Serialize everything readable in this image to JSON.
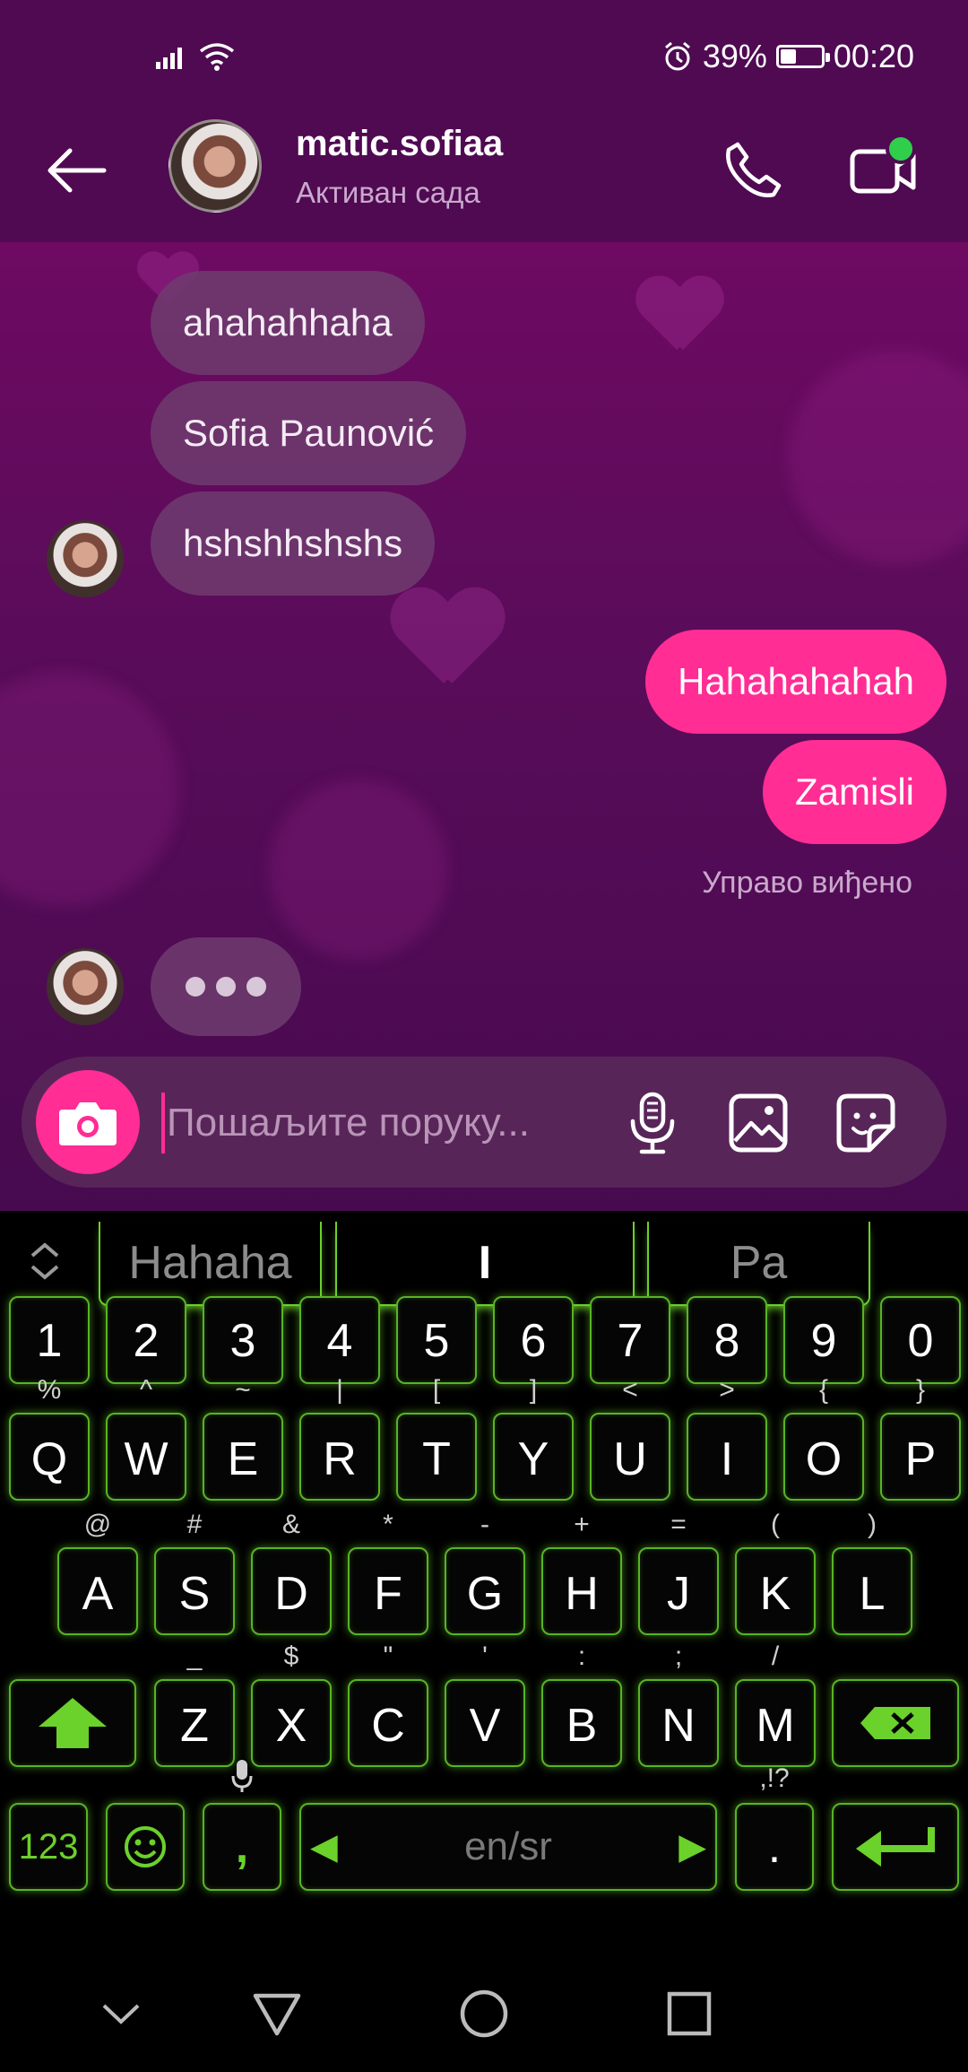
{
  "status_bar": {
    "battery": "39%",
    "battery_level": 0.39,
    "time": "00:20",
    "icons": [
      "signal-icon",
      "wifi-icon",
      "alarm-icon",
      "battery-icon"
    ]
  },
  "header": {
    "contact_name": "matic.sofiaa",
    "contact_status": "Активан сада",
    "icons": [
      "back-arrow-icon",
      "phone-icon",
      "video-call-icon"
    ]
  },
  "messages": [
    {
      "direction": "incoming",
      "text": "ahahahhaha"
    },
    {
      "direction": "incoming",
      "text": "Sofia Paunović"
    },
    {
      "direction": "incoming",
      "text": "hshshhshshs"
    },
    {
      "direction": "outgoing",
      "text": "Hahahahahah"
    },
    {
      "direction": "outgoing",
      "text": "Zamisli"
    }
  ],
  "seen_label": "Управо виђено",
  "composer": {
    "placeholder": "Пошаљите поруку...",
    "icons": [
      "camera-icon",
      "microphone-icon",
      "gallery-icon",
      "sticker-icon"
    ]
  },
  "keyboard": {
    "suggestions": [
      "Hahaha",
      "I",
      "Pa"
    ],
    "number_row": [
      "1",
      "2",
      "3",
      "4",
      "5",
      "6",
      "7",
      "8",
      "9",
      "0"
    ],
    "row1": [
      {
        "main": "Q",
        "sub": "%"
      },
      {
        "main": "W",
        "sub": "^"
      },
      {
        "main": "E",
        "sub": "~"
      },
      {
        "main": "R",
        "sub": "|"
      },
      {
        "main": "T",
        "sub": "["
      },
      {
        "main": "Y",
        "sub": "]"
      },
      {
        "main": "U",
        "sub": "<"
      },
      {
        "main": "I",
        "sub": ">"
      },
      {
        "main": "O",
        "sub": "{"
      },
      {
        "main": "P",
        "sub": "}"
      }
    ],
    "row2": [
      {
        "main": "A",
        "sub": "@"
      },
      {
        "main": "S",
        "sub": "#"
      },
      {
        "main": "D",
        "sub": "&"
      },
      {
        "main": "F",
        "sub": "*"
      },
      {
        "main": "G",
        "sub": "-"
      },
      {
        "main": "H",
        "sub": "+"
      },
      {
        "main": "J",
        "sub": "="
      },
      {
        "main": "K",
        "sub": "("
      },
      {
        "main": "L",
        "sub": ")"
      }
    ],
    "row3": [
      {
        "main": "Z",
        "sub": "_"
      },
      {
        "main": "X",
        "sub": "$"
      },
      {
        "main": "C",
        "sub": "\""
      },
      {
        "main": "V",
        "sub": "'"
      },
      {
        "main": "B",
        "sub": ":"
      },
      {
        "main": "N",
        "sub": ";"
      },
      {
        "main": "M",
        "sub": "/"
      }
    ],
    "numbers_key": "123",
    "comma_key": ",",
    "space_label": "en/sr",
    "period_key": ".",
    "period_sub": ",!?"
  },
  "accent_colors": {
    "pink": "#ff2d94",
    "green": "#6bd12b",
    "header_bg": "#4f0a52"
  }
}
